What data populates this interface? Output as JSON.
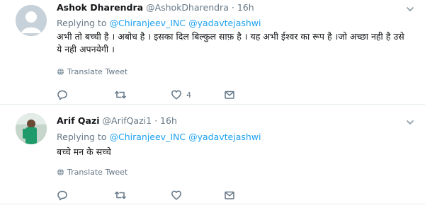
{
  "tweets": [
    {
      "display_name": "Ashok Dharendra",
      "handle": "@AshokDharendra",
      "separator": "·",
      "time": "16h",
      "replying_label": "Replying to",
      "mentions": [
        "@Chiranjeev_INC",
        "@yadavtejashwi"
      ],
      "text": "अभी तो बच्ची है । अबोध है । इसका दिल बिल्कुल साफ़ है । यह अभी ईश्वर का रूप है ।जो अच्छा नही है उसे ये नही अपनयेगी ।",
      "translate_label": "Translate Tweet",
      "like_count": "4"
    },
    {
      "display_name": "Arif Qazi",
      "handle": "@ArifQazi1",
      "separator": "·",
      "time": "16h",
      "replying_label": "Replying to",
      "mentions": [
        "@Chiranjeev_INC",
        "@yadavtejashwi"
      ],
      "text": "बच्चे मन के सच्चे",
      "translate_label": "Translate Tweet",
      "like_count": ""
    }
  ],
  "icons": {
    "reply": "reply-icon",
    "retweet": "retweet-icon",
    "like": "heart-icon",
    "message": "envelope-icon",
    "translate": "globe-icon",
    "caret": "chevron-down-icon"
  },
  "colors": {
    "link": "#1da1f2",
    "secondary_text": "#657786",
    "divider": "#e6ecf0"
  }
}
